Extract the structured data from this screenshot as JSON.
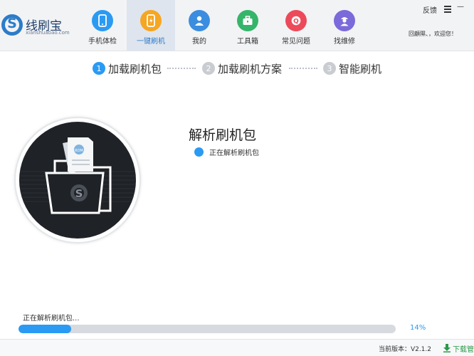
{
  "app": {
    "logo_title": "线刷宝",
    "logo_sub": "xianshuabao.com",
    "brand_color": "#2c7cc9"
  },
  "nav": {
    "items": [
      {
        "label": "手机体检",
        "icon": "phone-checkup-icon",
        "color": "#2b9af3"
      },
      {
        "label": "一键刷机",
        "icon": "one-click-flash-icon",
        "color": "#f5a623",
        "active": true
      },
      {
        "label": "我的",
        "icon": "user-icon",
        "color": "#3b8de0"
      },
      {
        "label": "工具箱",
        "icon": "toolbox-icon",
        "color": "#35b56a"
      },
      {
        "label": "常见问题",
        "icon": "question-icon",
        "color": "#ec4a5a"
      },
      {
        "label": "找维修",
        "icon": "repair-person-icon",
        "color": "#7b6ad9"
      }
    ]
  },
  "top_right": {
    "feedback": "反馈",
    "greeting": "回顧隰、，欢迎您！"
  },
  "steps": [
    {
      "num": "1",
      "label": "加载刷机包",
      "active": true
    },
    {
      "num": "2",
      "label": "加载刷机方案",
      "active": false
    },
    {
      "num": "3",
      "label": "智能刷机",
      "active": false
    }
  ],
  "main": {
    "title": "解析刷机包",
    "status": "正在解析刷机包"
  },
  "progress": {
    "label": "正在解析刷机包...",
    "percent_text": "14%",
    "value": 0.14
  },
  "footer": {
    "version": "当前版本：V2.1.2",
    "download": "下载管"
  }
}
